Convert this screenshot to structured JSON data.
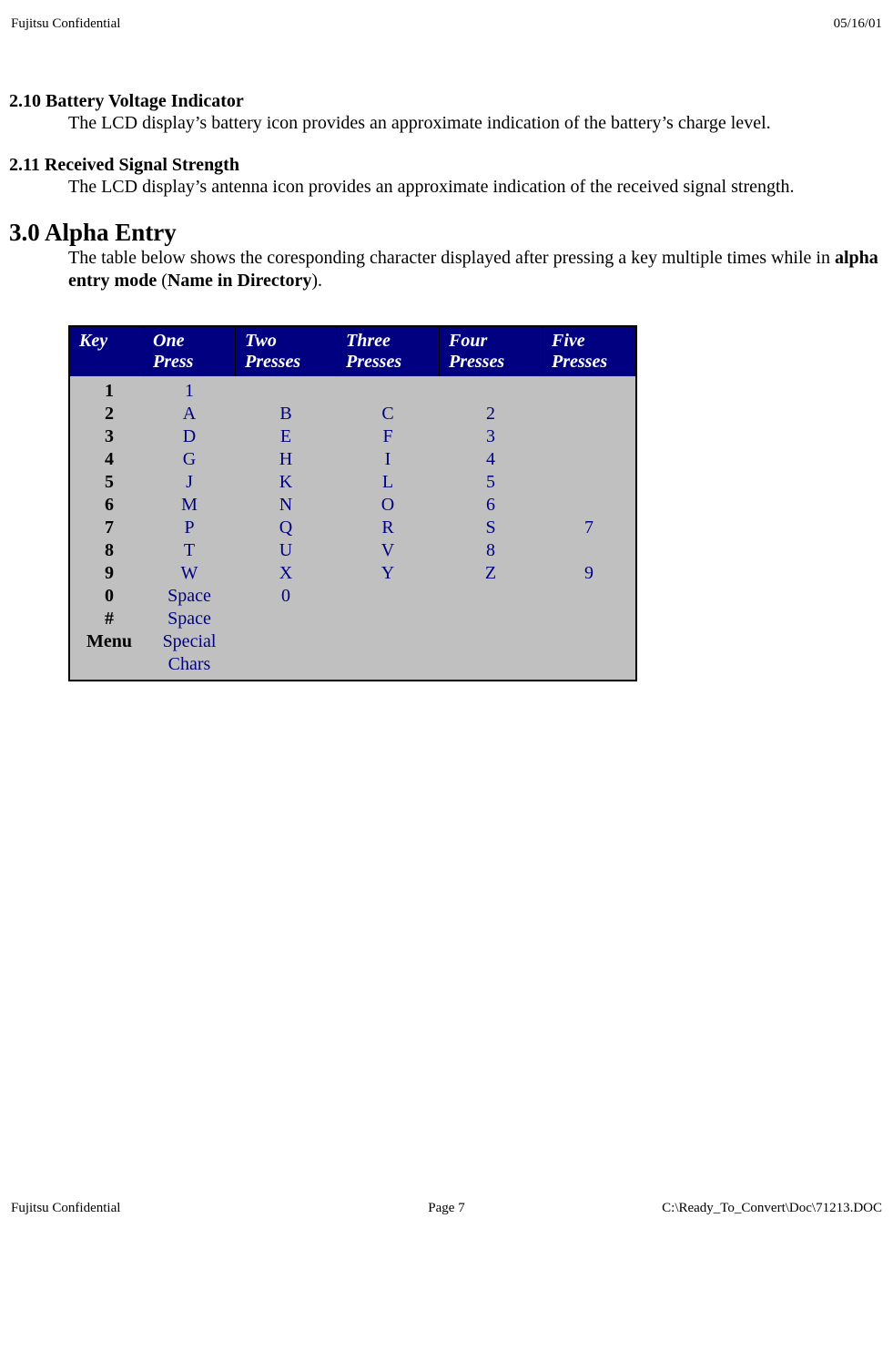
{
  "header": {
    "left": "Fujitsu Confidential",
    "right": "05/16/01"
  },
  "footer": {
    "left": "Fujitsu Confidential",
    "center": "Page 7",
    "right": "C:\\Ready_To_Convert\\Doc\\71213.DOC"
  },
  "sections": {
    "s210": {
      "heading": "2.10 Battery Voltage Indicator",
      "body": "The LCD display’s battery icon provides an approximate indication of the battery’s charge level."
    },
    "s211": {
      "heading": "2.11 Received Signal Strength",
      "body": "The LCD display’s antenna icon provides an approximate indication of the received signal strength."
    },
    "s30": {
      "heading": "3.0 Alpha Entry",
      "body_pre": "The table below shows the coresponding character displayed after pressing a key multiple times while in ",
      "body_bold1": "alpha entry mode",
      "body_mid": " (",
      "body_bold2": "Name in Directory",
      "body_post": ")."
    }
  },
  "chart_data": {
    "type": "table",
    "title": "Alpha Entry characters per key press",
    "headers": {
      "key": "Key",
      "one": {
        "line1": "One",
        "line2": "Press"
      },
      "two": {
        "line1": "Two",
        "line2": "Presses"
      },
      "three": {
        "line1": "Three",
        "line2": "Presses"
      },
      "four": {
        "line1": "Four",
        "line2": "Presses"
      },
      "five": {
        "line1": "Five",
        "line2": "Presses"
      }
    },
    "rows": [
      {
        "key": "1",
        "one": "1",
        "two": "",
        "three": "",
        "four": "",
        "five": ""
      },
      {
        "key": "2",
        "one": "A",
        "two": "B",
        "three": "C",
        "four": "2",
        "five": ""
      },
      {
        "key": "3",
        "one": "D",
        "two": "E",
        "three": "F",
        "four": "3",
        "five": ""
      },
      {
        "key": "4",
        "one": "G",
        "two": "H",
        "three": "I",
        "four": "4",
        "five": ""
      },
      {
        "key": "5",
        "one": "J",
        "two": "K",
        "three": "L",
        "four": "5",
        "five": ""
      },
      {
        "key": "6",
        "one": "M",
        "two": "N",
        "three": "O",
        "four": "6",
        "five": ""
      },
      {
        "key": "7",
        "one": "P",
        "two": "Q",
        "three": "R",
        "four": "S",
        "five": "7"
      },
      {
        "key": "8",
        "one": "T",
        "two": "U",
        "three": "V",
        "four": "8",
        "five": ""
      },
      {
        "key": "9",
        "one": "W",
        "two": "X",
        "three": "Y",
        "four": "Z",
        "five": "9"
      },
      {
        "key": "0",
        "one": "Space",
        "two": "0",
        "three": "",
        "four": "",
        "five": ""
      },
      {
        "key": "#",
        "one": "Space",
        "two": "",
        "three": "",
        "four": "",
        "five": ""
      },
      {
        "key": "Menu",
        "one": "Special Chars",
        "two": "",
        "three": "",
        "four": "",
        "five": ""
      }
    ]
  }
}
